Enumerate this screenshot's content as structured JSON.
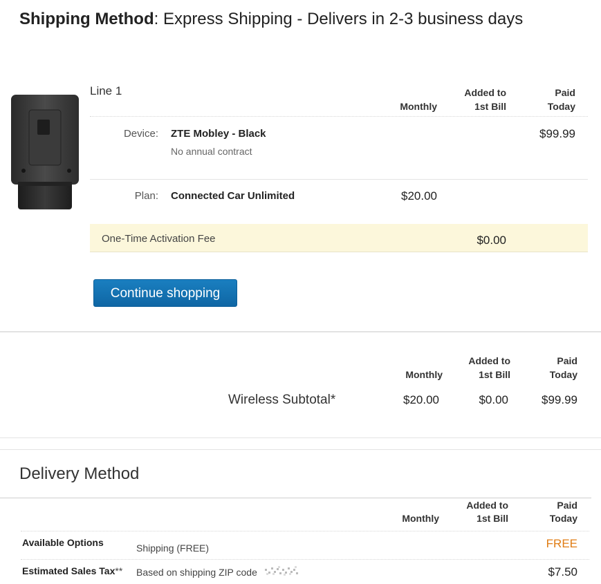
{
  "shipping": {
    "label": "Shipping Method",
    "value": ": Express Shipping - Delivers in 2-3 business days"
  },
  "line": {
    "title": "Line 1",
    "columns": {
      "monthly": "Monthly",
      "added_line1": "Added to",
      "added_line2": "1st Bill",
      "paid_line1": "Paid",
      "paid_line2": "Today"
    },
    "device": {
      "label": "Device:",
      "name": "ZTE Mobley - Black",
      "note": "No annual contract",
      "paid_today": "$99.99"
    },
    "plan": {
      "label": "Plan:",
      "name": "Connected Car Unlimited",
      "monthly": "$20.00"
    },
    "activation": {
      "label": "One-Time Activation Fee",
      "added_to_bill": "$0.00"
    }
  },
  "continue_button": "Continue shopping",
  "subtotal": {
    "columns": {
      "monthly": "Monthly",
      "added_line1": "Added to",
      "added_line2": "1st Bill",
      "paid_line1": "Paid",
      "paid_line2": "Today"
    },
    "label": "Wireless Subtotal*",
    "monthly": "$20.00",
    "added_to_bill": "$0.00",
    "paid_today": "$99.99"
  },
  "delivery": {
    "title": "Delivery Method",
    "columns": {
      "monthly": "Monthly",
      "added_line1": "Added to",
      "added_line2": "1st Bill",
      "paid_line1": "Paid",
      "paid_line2": "Today"
    },
    "options_label": "Available Options",
    "options_value": "Shipping (FREE)",
    "options_price": "FREE",
    "tax_label": "Estimated Sales Tax",
    "tax_marker": "**",
    "tax_value": "Based on shipping ZIP code",
    "tax_price": "$7.50"
  },
  "colors": {
    "button": "#1178b8",
    "free": "#e07b12",
    "fee_band": "#fcf7db"
  }
}
